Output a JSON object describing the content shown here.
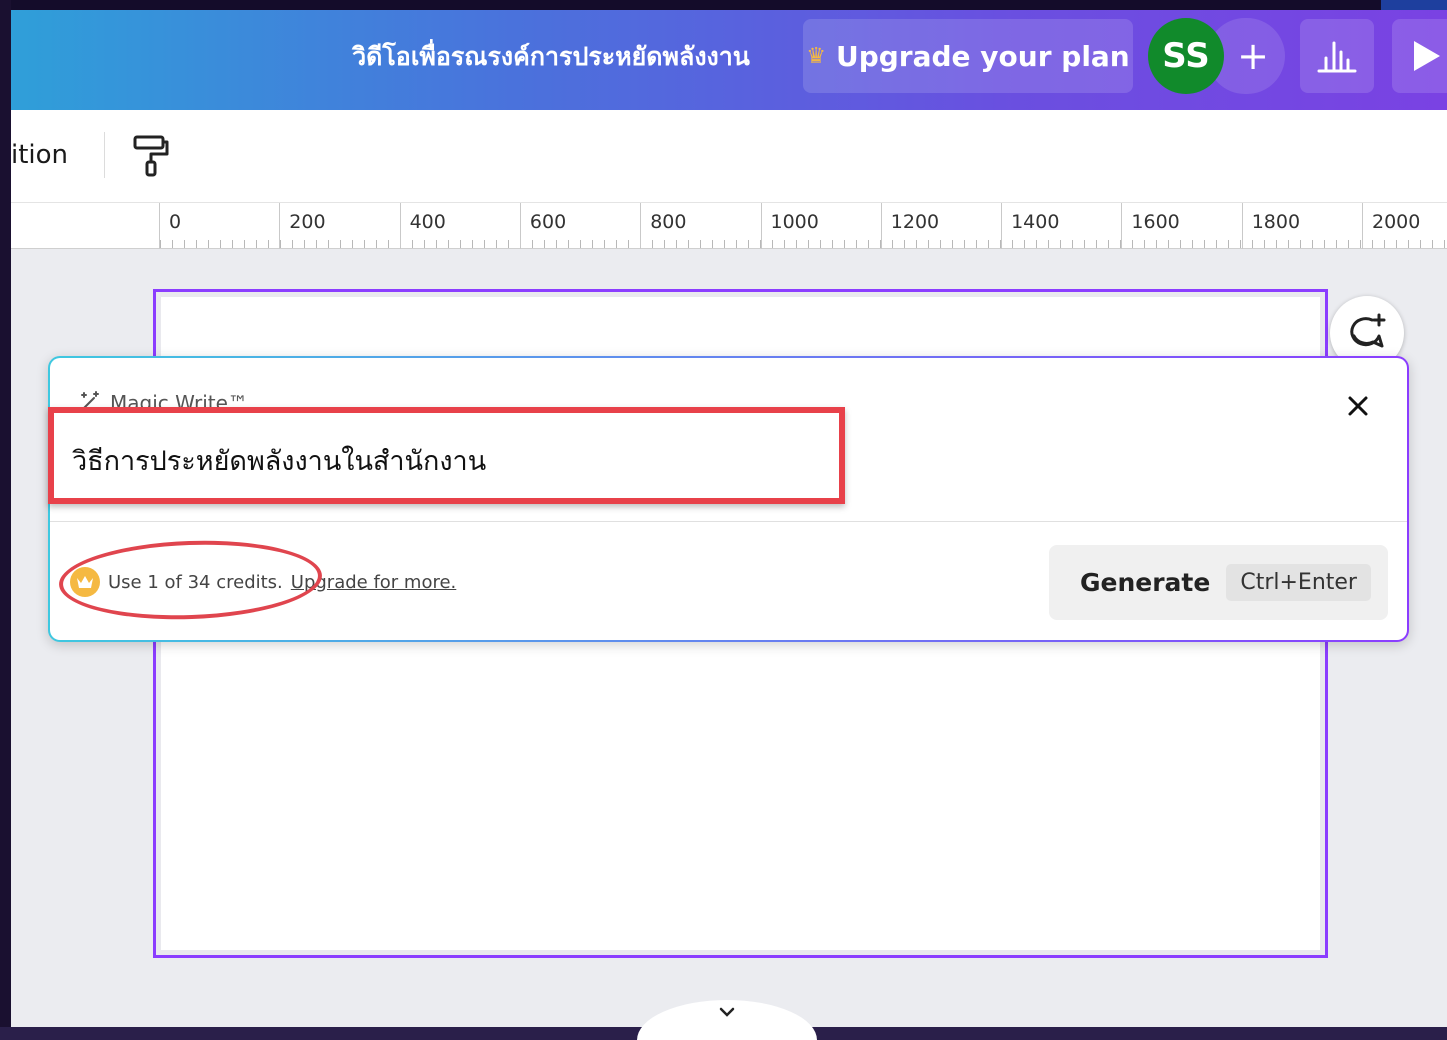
{
  "header": {
    "doc_title": "วิดีโอเพื่อรณรงค์การประหยัดพลังงาน",
    "upgrade_label": "Upgrade your plan",
    "upgrade_icon": "crown-icon",
    "avatar_initials": "SS",
    "add_label": "+",
    "analytics_icon": "bar-chart-icon",
    "present_icon": "play-icon"
  },
  "toolbar": {
    "position_label": "ition",
    "paint_icon": "paint-roller-icon"
  },
  "ruler": {
    "ticks": [
      "0",
      "200",
      "400",
      "600",
      "800",
      "1000",
      "1200",
      "1400",
      "1600",
      "1800",
      "2000"
    ]
  },
  "magic_write": {
    "title": "Magic Write™",
    "prompt_value": "วิธีการประหยัดพลังงานในสำนักงาน",
    "credits_text": "Use 1 of 34 credits.",
    "credits_link": "Upgrade for more.",
    "generate_label": "Generate",
    "shortcut": "Ctrl+Enter"
  },
  "colors": {
    "accent": "#8b3dff",
    "annotation": "#e8414a",
    "avatar": "#118a2b",
    "crown": "#f5b942"
  }
}
